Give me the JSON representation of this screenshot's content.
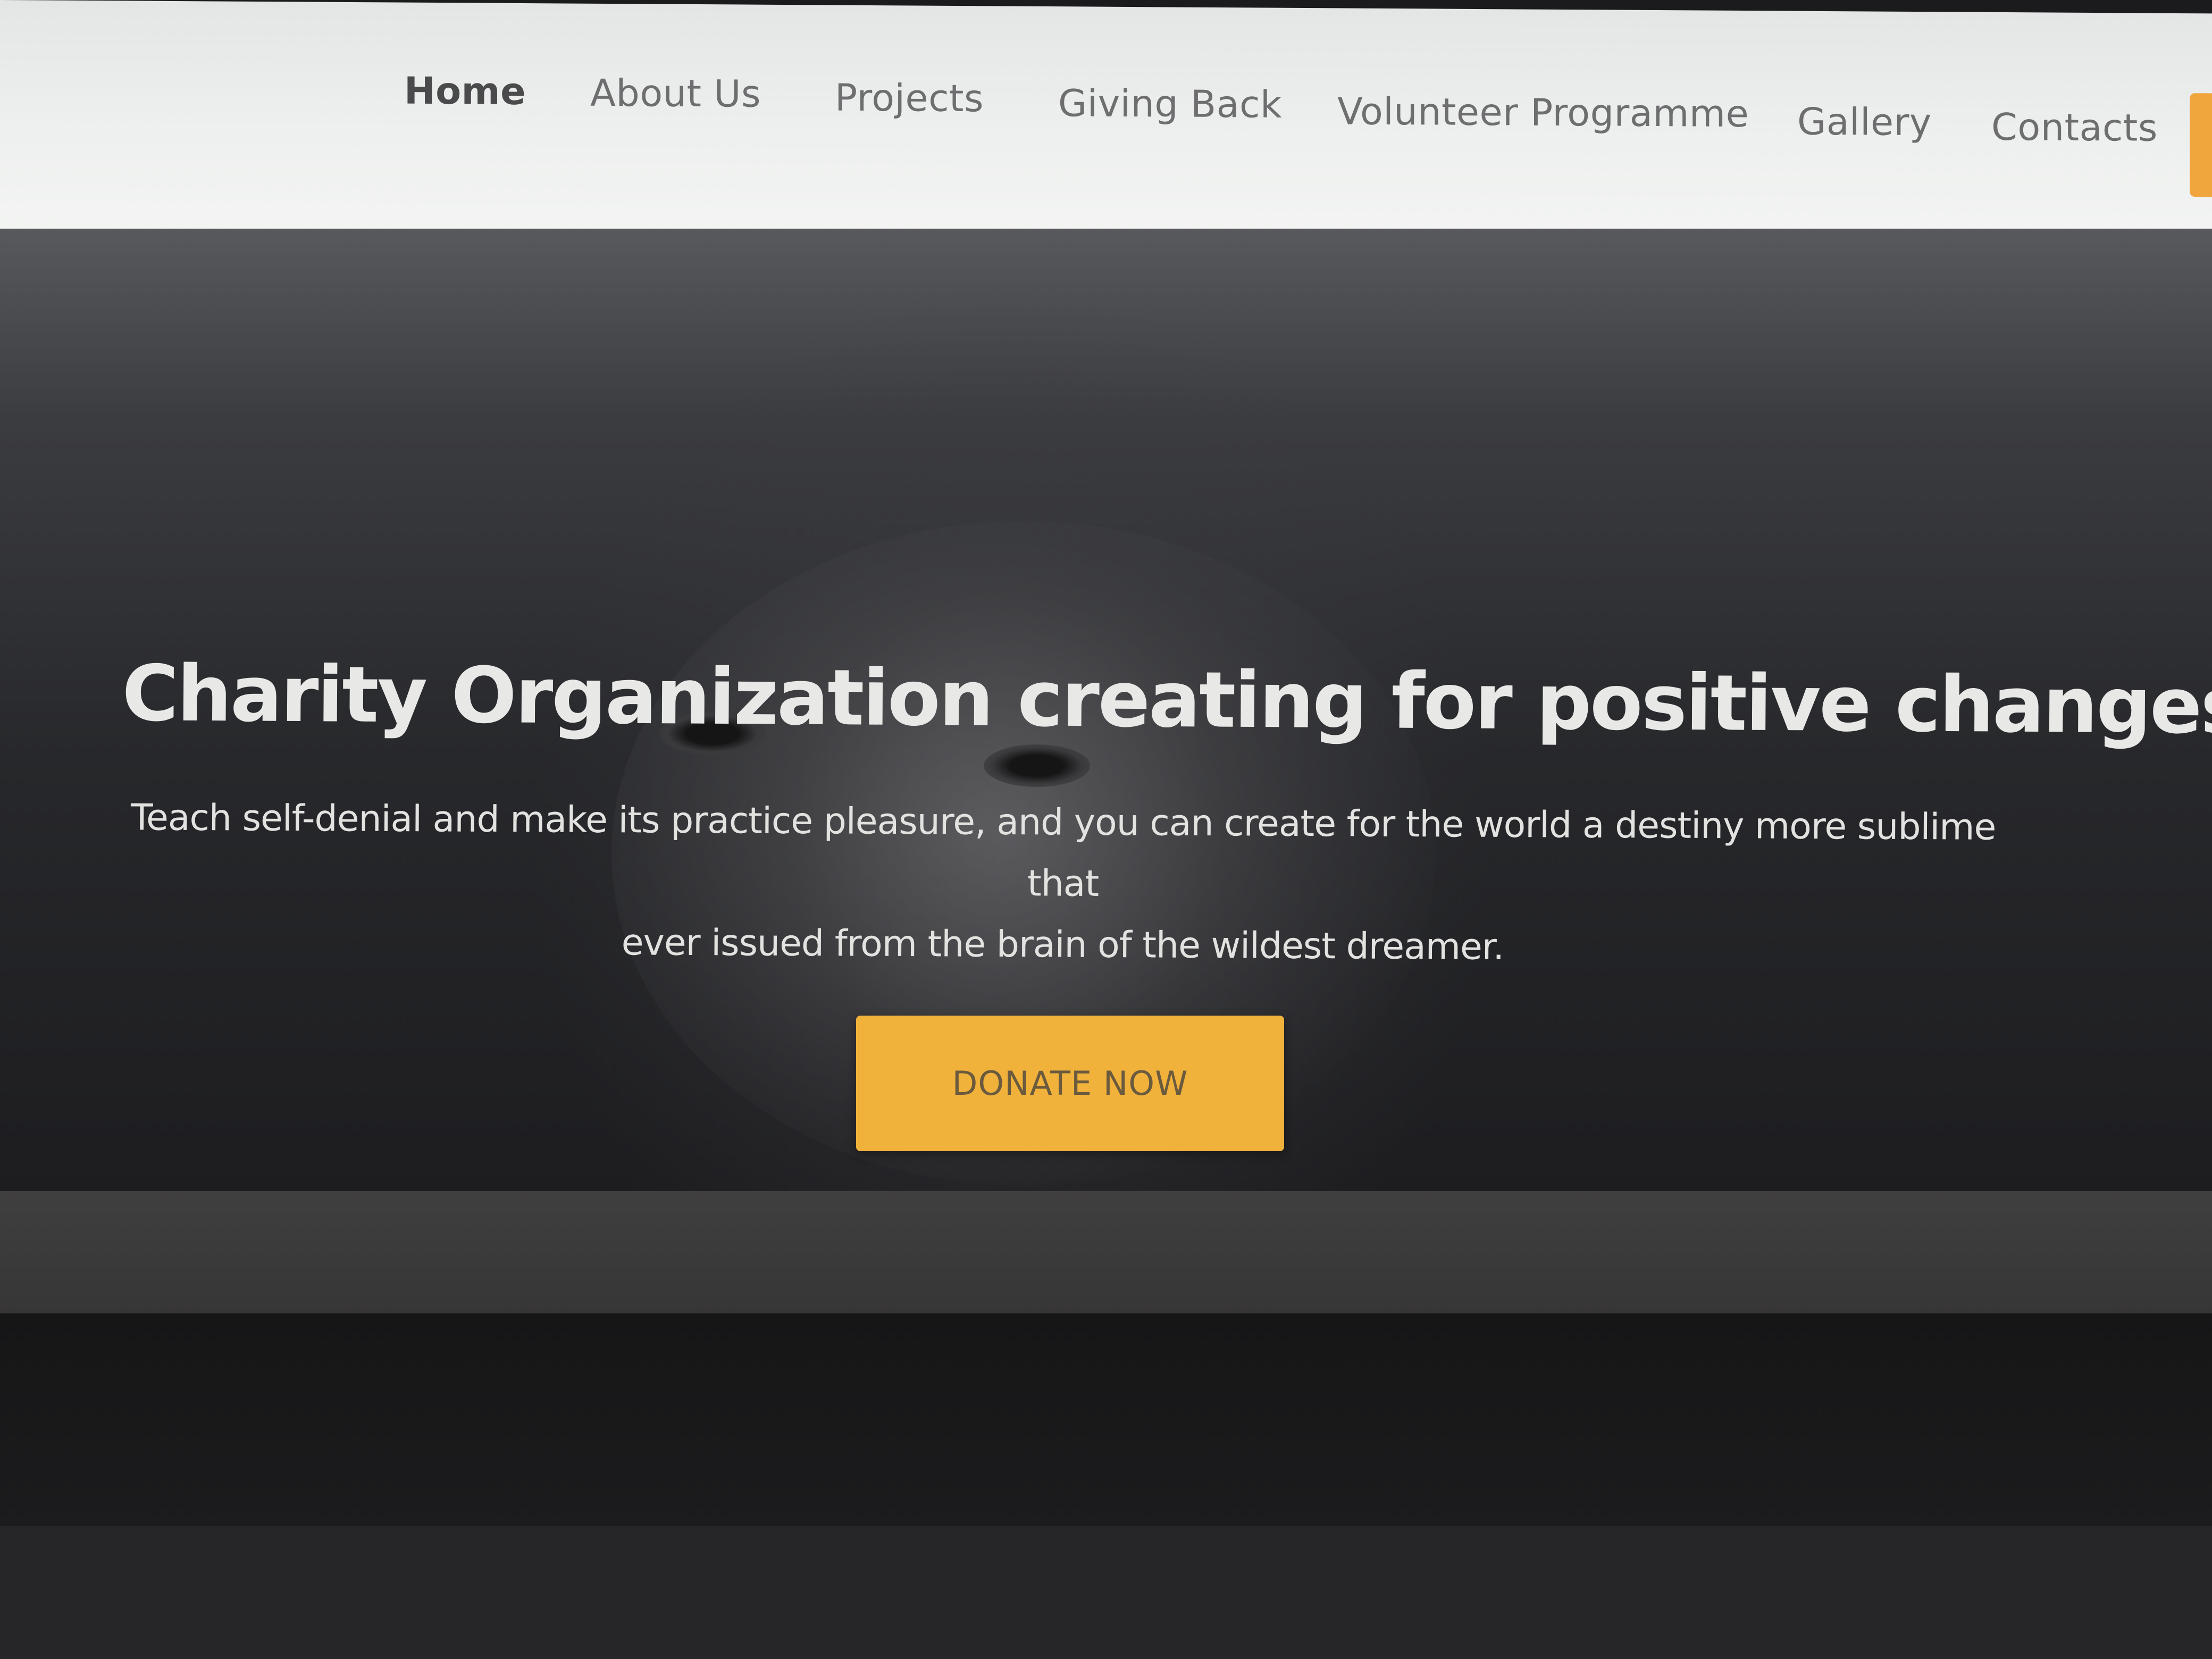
{
  "nav": {
    "items": [
      {
        "label": "Home",
        "active": true
      },
      {
        "label": "About Us",
        "active": false
      },
      {
        "label": "Projects",
        "active": false
      },
      {
        "label": "Giving Back",
        "active": false
      },
      {
        "label": "Volunteer Programme",
        "active": false
      },
      {
        "label": "Gallery",
        "active": false
      },
      {
        "label": "Contacts",
        "active": false
      }
    ]
  },
  "hero": {
    "title": "Charity Organization creating for positive changes",
    "subtitle_line1": "Teach self-denial and make its practice pleasure, and you can create for the world a destiny more sublime that",
    "subtitle_line2": "ever issued from the brain of the wildest dreamer.",
    "cta_label": "DONATE NOW"
  },
  "colors": {
    "accent": "#f1b23c",
    "nav_background": "#eef0ef",
    "hero_overlay": "#27282b",
    "text_light": "#e8e8e6"
  }
}
